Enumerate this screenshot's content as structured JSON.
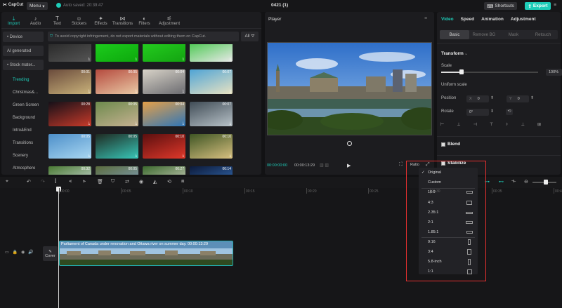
{
  "titlebar": {
    "app_name": "CapCut",
    "menu_label": "Menu",
    "autosave": "Auto saved: 20:39:47",
    "project_title": "0421 (1)",
    "shortcuts_label": "Shortcuts",
    "export_label": "Export"
  },
  "media_tabs": [
    {
      "label": "Import",
      "icon": "import-icon"
    },
    {
      "label": "Audio",
      "icon": "audio-icon"
    },
    {
      "label": "Text",
      "icon": "text-icon"
    },
    {
      "label": "Stickers",
      "icon": "stickers-icon"
    },
    {
      "label": "Effects",
      "icon": "effects-icon"
    },
    {
      "label": "Transitions",
      "icon": "transitions-icon"
    },
    {
      "label": "Filters",
      "icon": "filters-icon"
    },
    {
      "label": "Adjustment",
      "icon": "adjustment-icon"
    }
  ],
  "sidebar": {
    "device": "• Device",
    "ai_generated": "AI generated",
    "stock": "• Stock mater...",
    "categories": [
      "Trending",
      "Christmas&...",
      "Green Screen",
      "Background",
      "Intro&End",
      "Transitions",
      "Scenery",
      "Atmosphere"
    ]
  },
  "notice_text": "To avoid copyright infringement, do not export materials without editing them on CapCut.",
  "all_filter": "All",
  "thumbs": [
    {
      "dur": ""
    },
    {
      "dur": ""
    },
    {
      "dur": ""
    },
    {
      "dur": ""
    },
    {
      "dur": "00:01"
    },
    {
      "dur": "00:05"
    },
    {
      "dur": "00:04"
    },
    {
      "dur": "00:07"
    },
    {
      "dur": "00:28"
    },
    {
      "dur": "00:05"
    },
    {
      "dur": "00:04"
    },
    {
      "dur": "00:07"
    },
    {
      "dur": "00:05"
    },
    {
      "dur": "00:05"
    },
    {
      "dur": "00:10"
    },
    {
      "dur": "00:10"
    },
    {
      "dur": "00:32"
    },
    {
      "dur": "00:05"
    },
    {
      "dur": "00:27"
    },
    {
      "dur": "00:14"
    }
  ],
  "player": {
    "title": "Player",
    "current_time": "00:00:00:00",
    "total_time": "00:00:13:29",
    "ratio_label": "Ratio"
  },
  "right_panel": {
    "tabs": [
      "Video",
      "Speed",
      "Animation",
      "Adjustment"
    ],
    "subtabs": [
      "Basic",
      "Remove BG",
      "Mask",
      "Retouch"
    ],
    "transform": "Transform",
    "scale": "Scale",
    "scale_value": "100%",
    "uniform_scale": "Uniform scale",
    "position": "Position",
    "pos_x_label": "X",
    "pos_x": "0",
    "pos_y_label": "Y",
    "pos_y": "0",
    "rotate": "Rotate",
    "rotate_value": "0°",
    "blend": "Blend",
    "stabilize": "Stabilize"
  },
  "timeline": {
    "ticks": [
      "00:00",
      "00:05",
      "00:10",
      "00:15",
      "00:20",
      "00:25",
      "00:30",
      "00:35",
      "00:40"
    ],
    "cover_label": "Cover",
    "clip_label": "Parliament of Canada under renovation and Ottawa river on summer day.  00:00:13:29"
  },
  "ratio_menu": {
    "items": [
      "Original",
      "Custom",
      "16:9",
      "4:3",
      "2.35:1",
      "2:1",
      "1.85:1",
      "9:16",
      "3:4",
      "5.8-inch",
      "1:1"
    ],
    "selected": "Original"
  },
  "colors": {
    "accent": "#1ecdb9",
    "highlight_box": "#e53030"
  }
}
